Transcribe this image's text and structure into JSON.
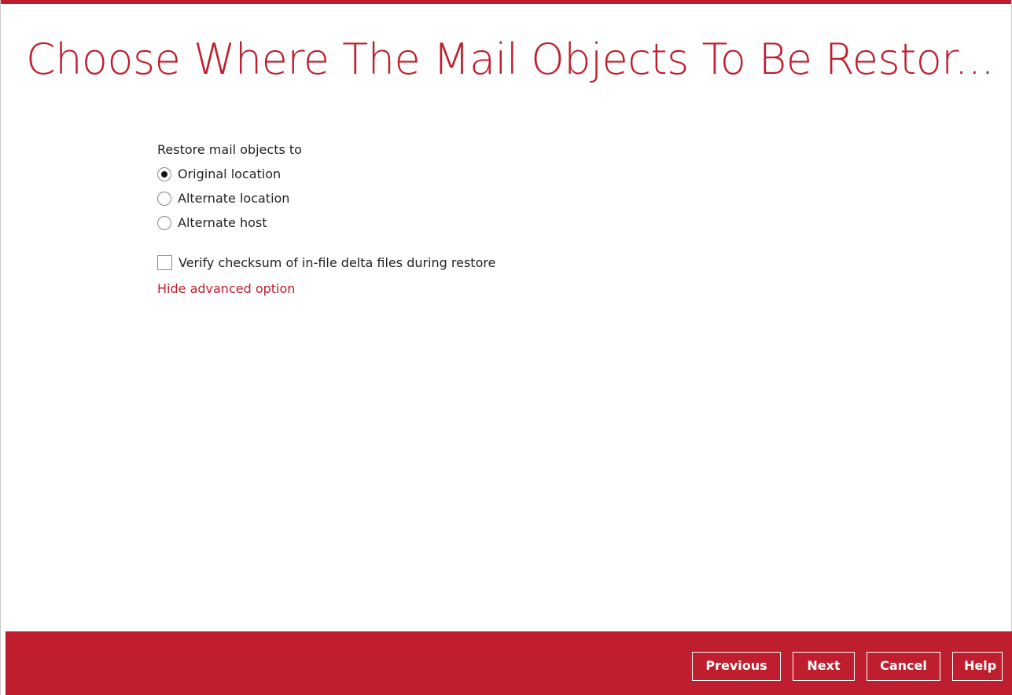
{
  "header": {
    "title": "Choose Where The Mail Objects To Be Restor..."
  },
  "restore_options": {
    "label": "Restore mail objects to",
    "options": [
      {
        "label": "Original location",
        "selected": true
      },
      {
        "label": "Alternate location",
        "selected": false
      },
      {
        "label": "Alternate host",
        "selected": false
      }
    ]
  },
  "advanced": {
    "verify_checksum_label": "Verify checksum of in-file delta files during restore",
    "verify_checksum_checked": false,
    "toggle_link": "Hide advanced option"
  },
  "footer": {
    "previous": "Previous",
    "next": "Next",
    "cancel": "Cancel",
    "help": "Help"
  },
  "colors": {
    "accent": "#be1e2d"
  }
}
